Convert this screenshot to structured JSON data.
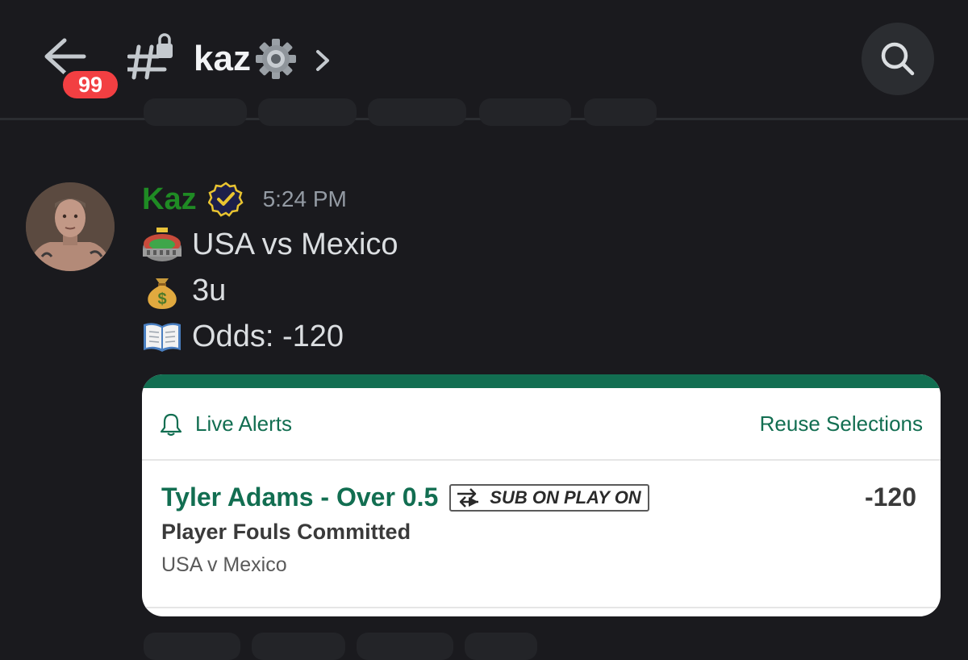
{
  "header": {
    "unread_count": "99",
    "channel_name": "kaz"
  },
  "message": {
    "author": "Kaz",
    "timestamp": "5:24 PM",
    "lines": [
      {
        "icon": "stadium-emoji",
        "text": "USA vs Mexico"
      },
      {
        "icon": "money-bag-emoji",
        "text": "3u"
      },
      {
        "icon": "open-book-emoji",
        "text": "Odds: -120"
      }
    ]
  },
  "bet_card": {
    "live_alerts_label": "Live Alerts",
    "reuse_label": "Reuse Selections",
    "selection_title": "Tyler Adams - Over 0.5",
    "tag_label": "SUB ON PLAY ON",
    "odds": "-120",
    "market": "Player Fouls Committed",
    "event": "USA v Mexico",
    "accent_color": "#126e51"
  },
  "colors": {
    "background": "#1a1a1e",
    "author_name": "#1f8b24",
    "badge": "#f23f42"
  }
}
